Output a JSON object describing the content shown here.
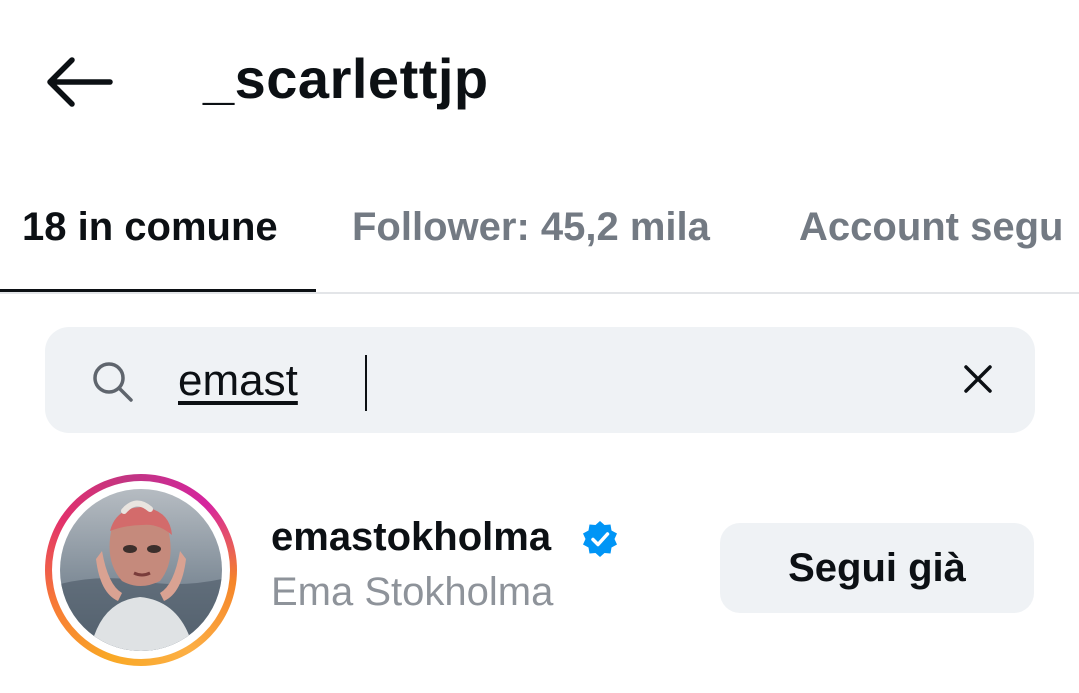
{
  "header": {
    "title": "_scarlettjp",
    "back_icon": "arrow-left-icon"
  },
  "tabs": [
    {
      "label": "18 in comune",
      "active": true
    },
    {
      "label": "Follower: 45,2 mila",
      "active": false
    },
    {
      "label": "Account segu",
      "active": false
    }
  ],
  "search": {
    "value": "emast",
    "icon": "search-icon",
    "clear_icon": "close-icon"
  },
  "results": [
    {
      "username": "emastokholma",
      "verified": true,
      "full_name": "Ema Stokholma",
      "button_label": "Segui già"
    }
  ],
  "colors": {
    "text_primary": "#0c1014",
    "text_secondary": "#737a83",
    "verified_blue": "#0095f6",
    "field_background": "#eff2f5"
  }
}
